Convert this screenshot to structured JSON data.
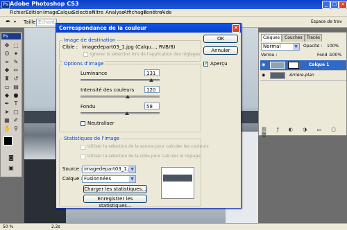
{
  "app": {
    "title": "Adobe Photoshop CS3",
    "icon_text": "Ps"
  },
  "menu": [
    "Fichier",
    "Edition",
    "Image",
    "Calque",
    "Sélection",
    "Filtre",
    "Analyse",
    "Affichage",
    "Fenêtre",
    "Aide"
  ],
  "options_bar": {
    "size_label": "Taille :",
    "sample_placeholder": "Echantillon",
    "workspace_label": "Espace de trav"
  },
  "status_bar": {
    "zoom": "50 %",
    "doc_info": "2.2s"
  },
  "layers_panel": {
    "tabs": [
      "Calques",
      "Couches",
      "Tracés"
    ],
    "blend_mode": "Normal",
    "opacity_label": "Opacité :",
    "opacity_value": "100%",
    "lock_label": "Verrou :",
    "fill_label": "Fond :",
    "fill_value": "100%",
    "layers": [
      {
        "name": "Calque 1",
        "selected": true
      },
      {
        "name": "Arrière-plan",
        "selected": false
      }
    ]
  },
  "dialog": {
    "title": "Correspondance de la couleur",
    "ok_label": "OK",
    "cancel_label": "Annuler",
    "preview_label": "Aperçu",
    "preview_checked": true,
    "destination": {
      "group_label": "Image de destination",
      "target_label": "Cible :",
      "target_value": "imagedepart03_1.jpg (Calqu..., RVB/8)",
      "ignore_selection_label": "Ignorer la sélection lors de l'application des réglages"
    },
    "options": {
      "group_label": "Options d'image",
      "luminance_label": "Luminance",
      "luminance_value": "131",
      "intensity_label": "Intensité des couleurs",
      "intensity_value": "120",
      "fade_label": "Fondu",
      "fade_value": "58",
      "neutralize_label": "Neutraliser"
    },
    "stats": {
      "group_label": "Statistiques de l'image",
      "use_source_selection": "Utiliser la sélection de la source pour calculer les couleurs",
      "use_target_selection": "Utiliser la sélection de la cible pour calculer le réglage",
      "source_label": "Source :",
      "source_value": "imagedepart03_1.jpg",
      "layer_label": "Calque :",
      "layer_value": "Fusionnées",
      "load_stats": "Charger les statistiques...",
      "save_stats": "Enregistrer les statistiques..."
    }
  }
}
